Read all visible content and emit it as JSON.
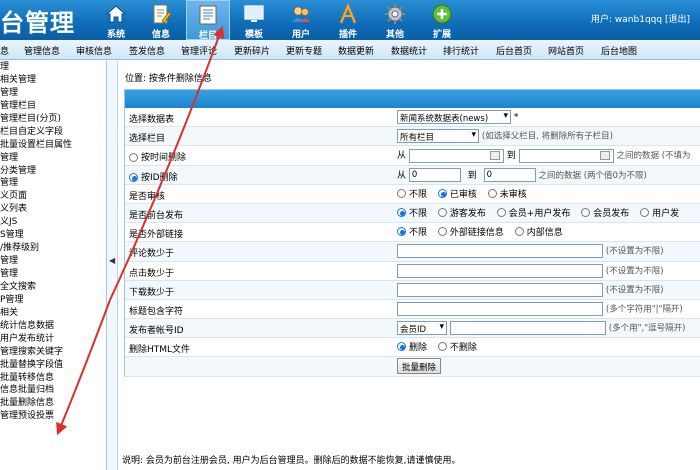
{
  "header": {
    "logo_text": "台管理",
    "nav": [
      {
        "label": "系统",
        "icon": "home-icon"
      },
      {
        "label": "信息",
        "icon": "document-edit-icon"
      },
      {
        "label": "栏目",
        "icon": "columns-icon",
        "active": true
      },
      {
        "label": "模板",
        "icon": "monitor-icon"
      },
      {
        "label": "用户",
        "icon": "users-icon"
      },
      {
        "label": "插件",
        "icon": "plugin-icon"
      },
      {
        "label": "其他",
        "icon": "gear-icon"
      },
      {
        "label": "扩展",
        "icon": "plus-icon"
      }
    ],
    "user_label": "用户: wanb1qqq",
    "logout": "[退出]"
  },
  "menubar": [
    "息",
    "管理信息",
    "审核信息",
    "签发信息",
    "管理评论",
    "更新碎片",
    "更新专题",
    "数据更新",
    "数据统计",
    "排行统计",
    "后台首页",
    "网站首页",
    "后台地图"
  ],
  "sidebar": [
    "理",
    "相关管理",
    "管理",
    "管理栏目",
    "管理栏目(分页)",
    "栏目自定义字段",
    "批量设置栏目属性",
    "管理",
    "分类管理",
    "管理",
    "义页面",
    "义列表",
    "义JS",
    "S管理",
    "/推荐级别",
    "管理",
    "管理",
    "全文搜索",
    "P管理",
    "相关",
    "统计信息数据",
    "用户发布统计",
    "管理搜索关键字",
    "批量替换字段值",
    "批量转移信息",
    "信息批量归档",
    "批量删除信息",
    "管理预设投票"
  ],
  "breadcrumb": "位置: 按条件删除信息",
  "form": {
    "table_label": "选择数据表",
    "table_value": "新闻系统数据表(news)",
    "table_star": "*",
    "column_label": "选择栏目",
    "column_value": "所有栏目",
    "column_hint": "(如选择父栏目, 将删除所有子栏目)",
    "by_time_label": "按时间删除",
    "from_label": "从",
    "to_label": "到",
    "time_hint": "之间的数据 (不填为",
    "by_id_label": "按ID删除",
    "id_from": "0",
    "id_to": "0",
    "id_hint": "之间的数据 (两个值0为不限)",
    "audit_label": "是否审核",
    "audit_options": [
      "不限",
      "已审核",
      "未审核"
    ],
    "front_label": "是否前台发布",
    "front_options": [
      "不限",
      "游客发布",
      "会员+用户发布",
      "会员发布",
      "用户发"
    ],
    "link_label": "是否外部链接",
    "link_options": [
      "不限",
      "外部链接信息",
      "内部信息"
    ],
    "comments_label": "评论数少于",
    "comments_hint": "(不设置为不限)",
    "clicks_label": "点击数少于",
    "clicks_hint": "(不设置为不限)",
    "downloads_label": "下载数少于",
    "downloads_hint": "(不设置为不限)",
    "title_label": "标题包含字符",
    "title_hint": "(多个字符用\"|\"隔开)",
    "publisher_label": "发布者帐号ID",
    "publisher_select": "会员ID",
    "publisher_hint": "(多个用\",\"逗号隔开)",
    "html_label": "删除HTML文件",
    "html_options": [
      "删除",
      "不删除"
    ],
    "submit": "批量删除"
  },
  "note": "说明: 会员为前台注册会员, 用户为后台管理员。删除后的数据不能恢复,请谨慎使用。",
  "colors": {
    "header": "#1a7cc6",
    "annotation_arrow": "#d9312b",
    "radio_accent": "#1a73e8"
  }
}
